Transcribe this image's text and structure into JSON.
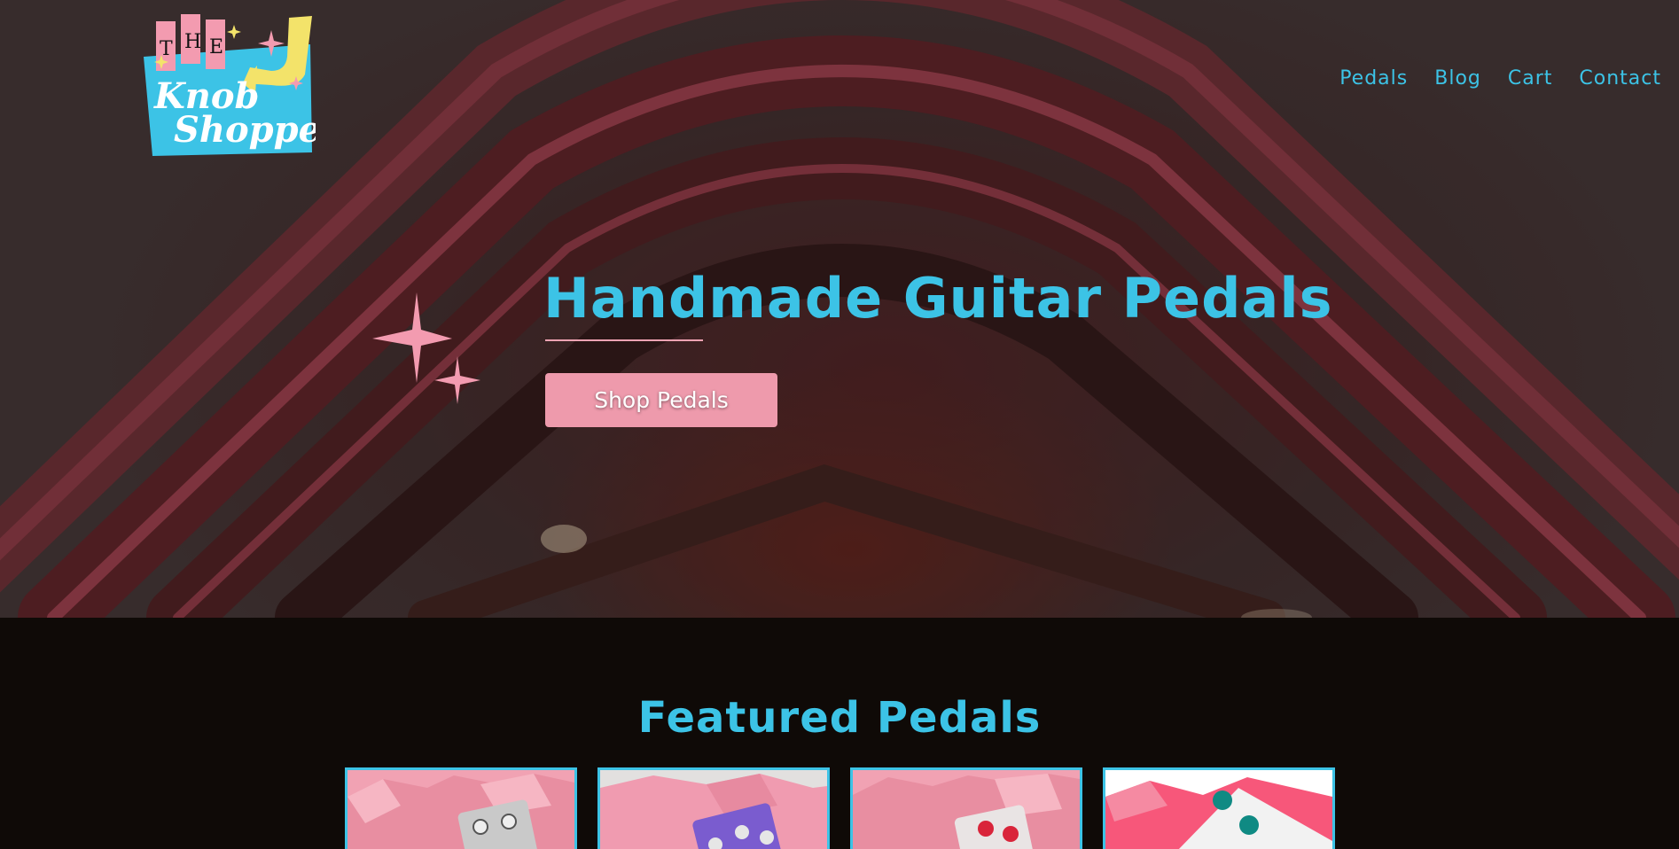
{
  "brand": {
    "logo_text_the": "THE",
    "logo_text_knob": "Knob",
    "logo_text_shoppe": "Shoppe",
    "colors": {
      "cyan": "#3cc3e6",
      "pink": "#ee9aac",
      "yellow": "#f3e36a"
    }
  },
  "nav": {
    "items": [
      {
        "label": "Pedals"
      },
      {
        "label": "Blog"
      },
      {
        "label": "Cart"
      },
      {
        "label": "Contact"
      }
    ]
  },
  "hero": {
    "title": "Handmade Guitar Pedals",
    "cta_label": "Shop Pedals"
  },
  "featured": {
    "title": "Featured Pedals",
    "products": [
      {
        "image": "silver-pedal-pink-box"
      },
      {
        "image": "purple-pedal-pink-box"
      },
      {
        "image": "white-red-knob-pedal-pink-box"
      },
      {
        "image": "white-teal-knob-pedal-pink-box"
      }
    ]
  }
}
